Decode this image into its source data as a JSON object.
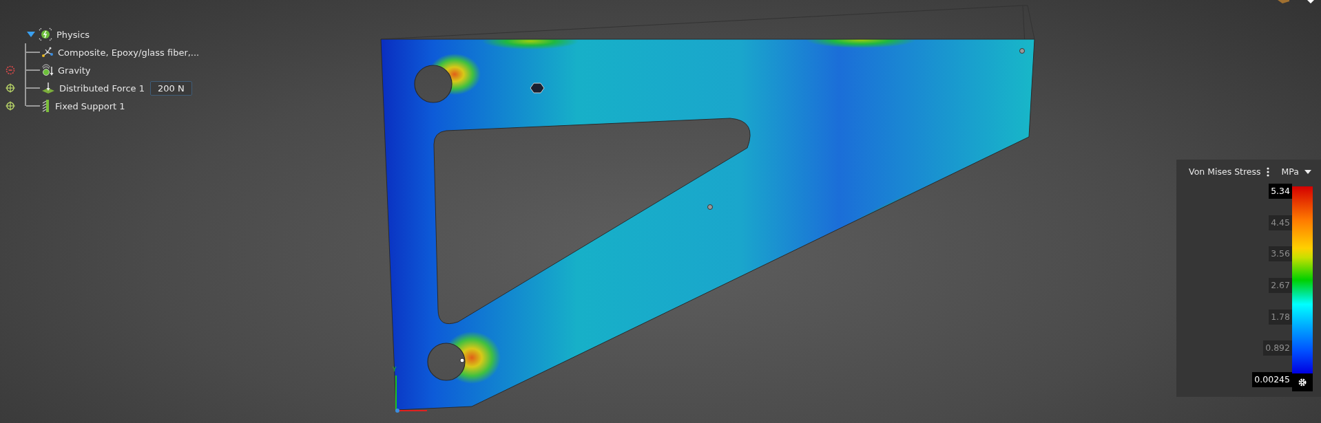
{
  "tree": {
    "label": "Physics",
    "expanded": true,
    "children": [
      {
        "label": "Composite, Epoxy/glass fiber,...",
        "kind": "material",
        "error": false,
        "targeted": false
      },
      {
        "label": "Gravity",
        "kind": "gravity",
        "error": true,
        "targeted": false
      },
      {
        "label": "Distributed Force 1",
        "kind": "force",
        "error": false,
        "targeted": true,
        "value": "200 N"
      },
      {
        "label": "Fixed Support 1",
        "kind": "support",
        "error": false,
        "targeted": true
      }
    ]
  },
  "viewport": {
    "axis_label": "Y"
  },
  "legend": {
    "title": "Von Mises Stress",
    "unit": "MPa",
    "labels": [
      {
        "text": "5.34",
        "kind": "extreme"
      },
      {
        "text": "4.45",
        "kind": "tick"
      },
      {
        "text": "3.56",
        "kind": "tick"
      },
      {
        "text": "2.67",
        "kind": "tick"
      },
      {
        "text": "1.78",
        "kind": "tick"
      },
      {
        "text": "0.892",
        "kind": "tick"
      },
      {
        "text": "0.00245",
        "kind": "extreme"
      }
    ]
  }
}
